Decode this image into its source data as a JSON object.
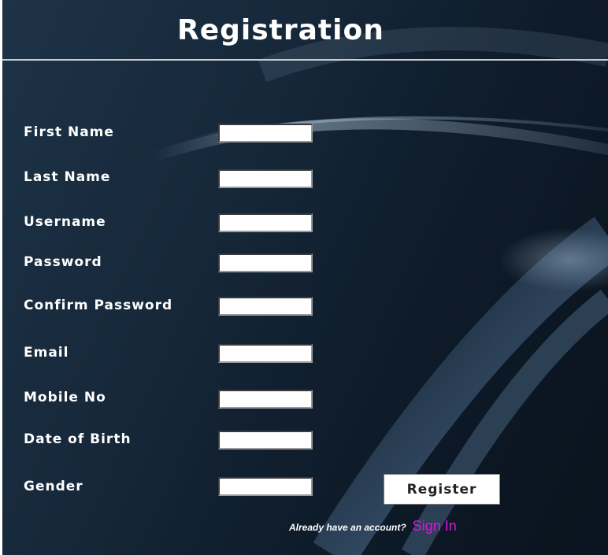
{
  "header": {
    "title": "Registration"
  },
  "form": {
    "fields": [
      {
        "id": "first-name",
        "label": "First Name",
        "value": ""
      },
      {
        "id": "last-name",
        "label": "Last Name",
        "value": ""
      },
      {
        "id": "username",
        "label": "Username",
        "value": ""
      },
      {
        "id": "password",
        "label": "Password",
        "value": ""
      },
      {
        "id": "confirm-password",
        "label": "Confirm Password",
        "value": ""
      },
      {
        "id": "email",
        "label": "Email",
        "value": ""
      },
      {
        "id": "mobile-no",
        "label": "Mobile No",
        "value": ""
      },
      {
        "id": "date-of-birth",
        "label": "Date of Birth",
        "value": ""
      },
      {
        "id": "gender",
        "label": "Gender",
        "value": ""
      }
    ],
    "register_label": "Register"
  },
  "footer": {
    "signin_prompt": "Already have an account?",
    "signin_link": "Sign In"
  },
  "colors": {
    "background": "#0f1d2c",
    "text": "#ffffff",
    "link": "#d916e0",
    "divider": "#c9ced4"
  }
}
